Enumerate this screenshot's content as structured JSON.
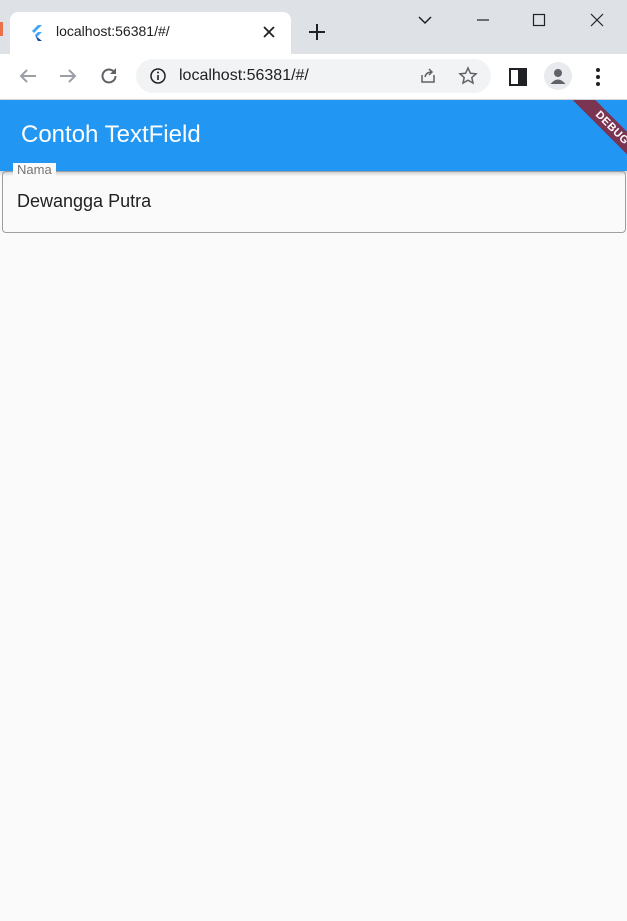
{
  "browser": {
    "tab": {
      "title": "localhost:56381/#/"
    },
    "omnibox": {
      "url": "localhost:56381/#/"
    }
  },
  "app": {
    "appbar": {
      "title": "Contoh TextField",
      "color": "#2196f3"
    },
    "debug_banner": "DEBUG",
    "textfield": {
      "label": "Nama",
      "value": "Dewangga Putra"
    }
  }
}
